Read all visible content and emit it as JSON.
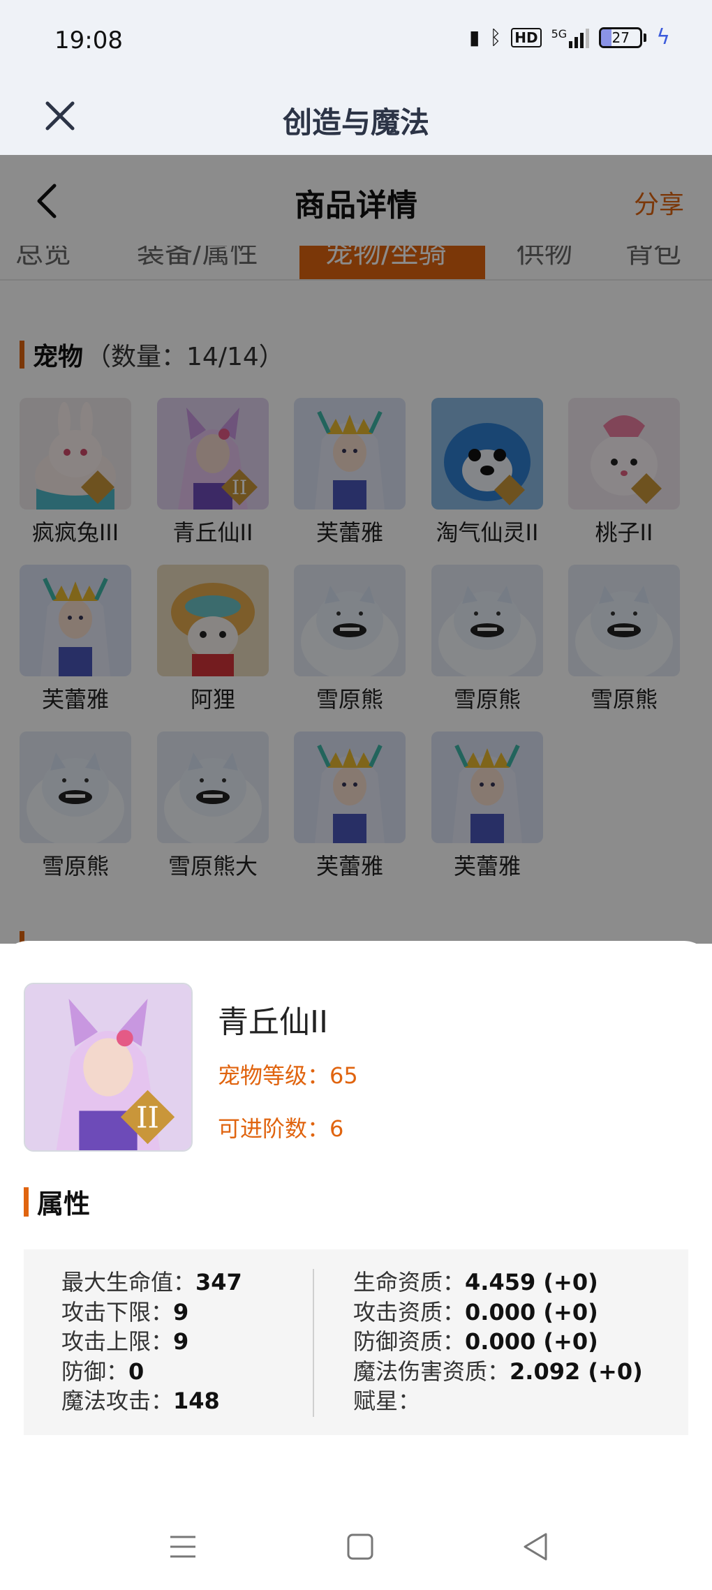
{
  "status": {
    "time": "19:08",
    "network": "5G",
    "hd_label": "HD",
    "battery": "27",
    "battery_level": 0.27
  },
  "app": {
    "title": "创造与魔法"
  },
  "header": {
    "title": "商品详情",
    "share_label": "分享"
  },
  "tabs": [
    {
      "label": "总览"
    },
    {
      "label": "装备/属性"
    },
    {
      "label": "宠物/坐骑"
    },
    {
      "label": "供物"
    },
    {
      "label": "背包"
    }
  ],
  "pets_section": {
    "title": "宠物",
    "count": "（数量：14/14）"
  },
  "pets": [
    {
      "name": "疯疯兔III",
      "color": "#f3e6e2",
      "icon": "rabbit"
    },
    {
      "name": "青丘仙II",
      "color": "#d9b8e8",
      "icon": "fox-fairy"
    },
    {
      "name": "芙蕾雅",
      "color": "#cdd7f2",
      "icon": "goddess"
    },
    {
      "name": "淘气仙灵II",
      "color": "#3b8ed6",
      "icon": "sprite"
    },
    {
      "name": "桃子II",
      "color": "#f6e2ea",
      "icon": "bunny"
    },
    {
      "name": "芙蕾雅",
      "color": "#cdd7f2",
      "icon": "goddess"
    },
    {
      "name": "阿狸",
      "color": "#e9c88f",
      "icon": "fox"
    },
    {
      "name": "雪原熊",
      "color": "#dde5f2",
      "icon": "bear"
    },
    {
      "name": "雪原熊",
      "color": "#dde5f2",
      "icon": "bear"
    },
    {
      "name": "雪原熊",
      "color": "#dde5f2",
      "icon": "bear"
    },
    {
      "name": "雪原熊",
      "color": "#dde5f2",
      "icon": "bear"
    },
    {
      "name": "雪原熊大",
      "color": "#dde5f2",
      "icon": "bear"
    },
    {
      "name": "芙蕾雅",
      "color": "#cdd7f2",
      "icon": "goddess"
    },
    {
      "name": "芙蕾雅",
      "color": "#cdd7f2",
      "icon": "goddess"
    }
  ],
  "selected_pet": {
    "name": "青丘仙II",
    "level_text": "宠物等级：65",
    "advance_text": "可进阶数：6"
  },
  "attributes_title": "属性",
  "attributes_left": [
    {
      "label": "最大生命值：",
      "value": "347"
    },
    {
      "label": "攻击下限：",
      "value": "9"
    },
    {
      "label": "攻击上限：",
      "value": "9"
    },
    {
      "label": "防御：",
      "value": "0"
    },
    {
      "label": "魔法攻击：",
      "value": "148"
    }
  ],
  "attributes_right": [
    {
      "label": "生命资质：",
      "value": "4.459 (+0)"
    },
    {
      "label": "攻击资质：",
      "value": "0.000 (+0)"
    },
    {
      "label": "防御资质：",
      "value": "0.000 (+0)"
    },
    {
      "label": "魔法伤害资质：",
      "value": "2.092 (+0)"
    },
    {
      "label": "赋星：",
      "value": ""
    }
  ],
  "theme": {
    "accent": "#e0640f",
    "overlay": "rgba(0,0,0,0.45)"
  }
}
